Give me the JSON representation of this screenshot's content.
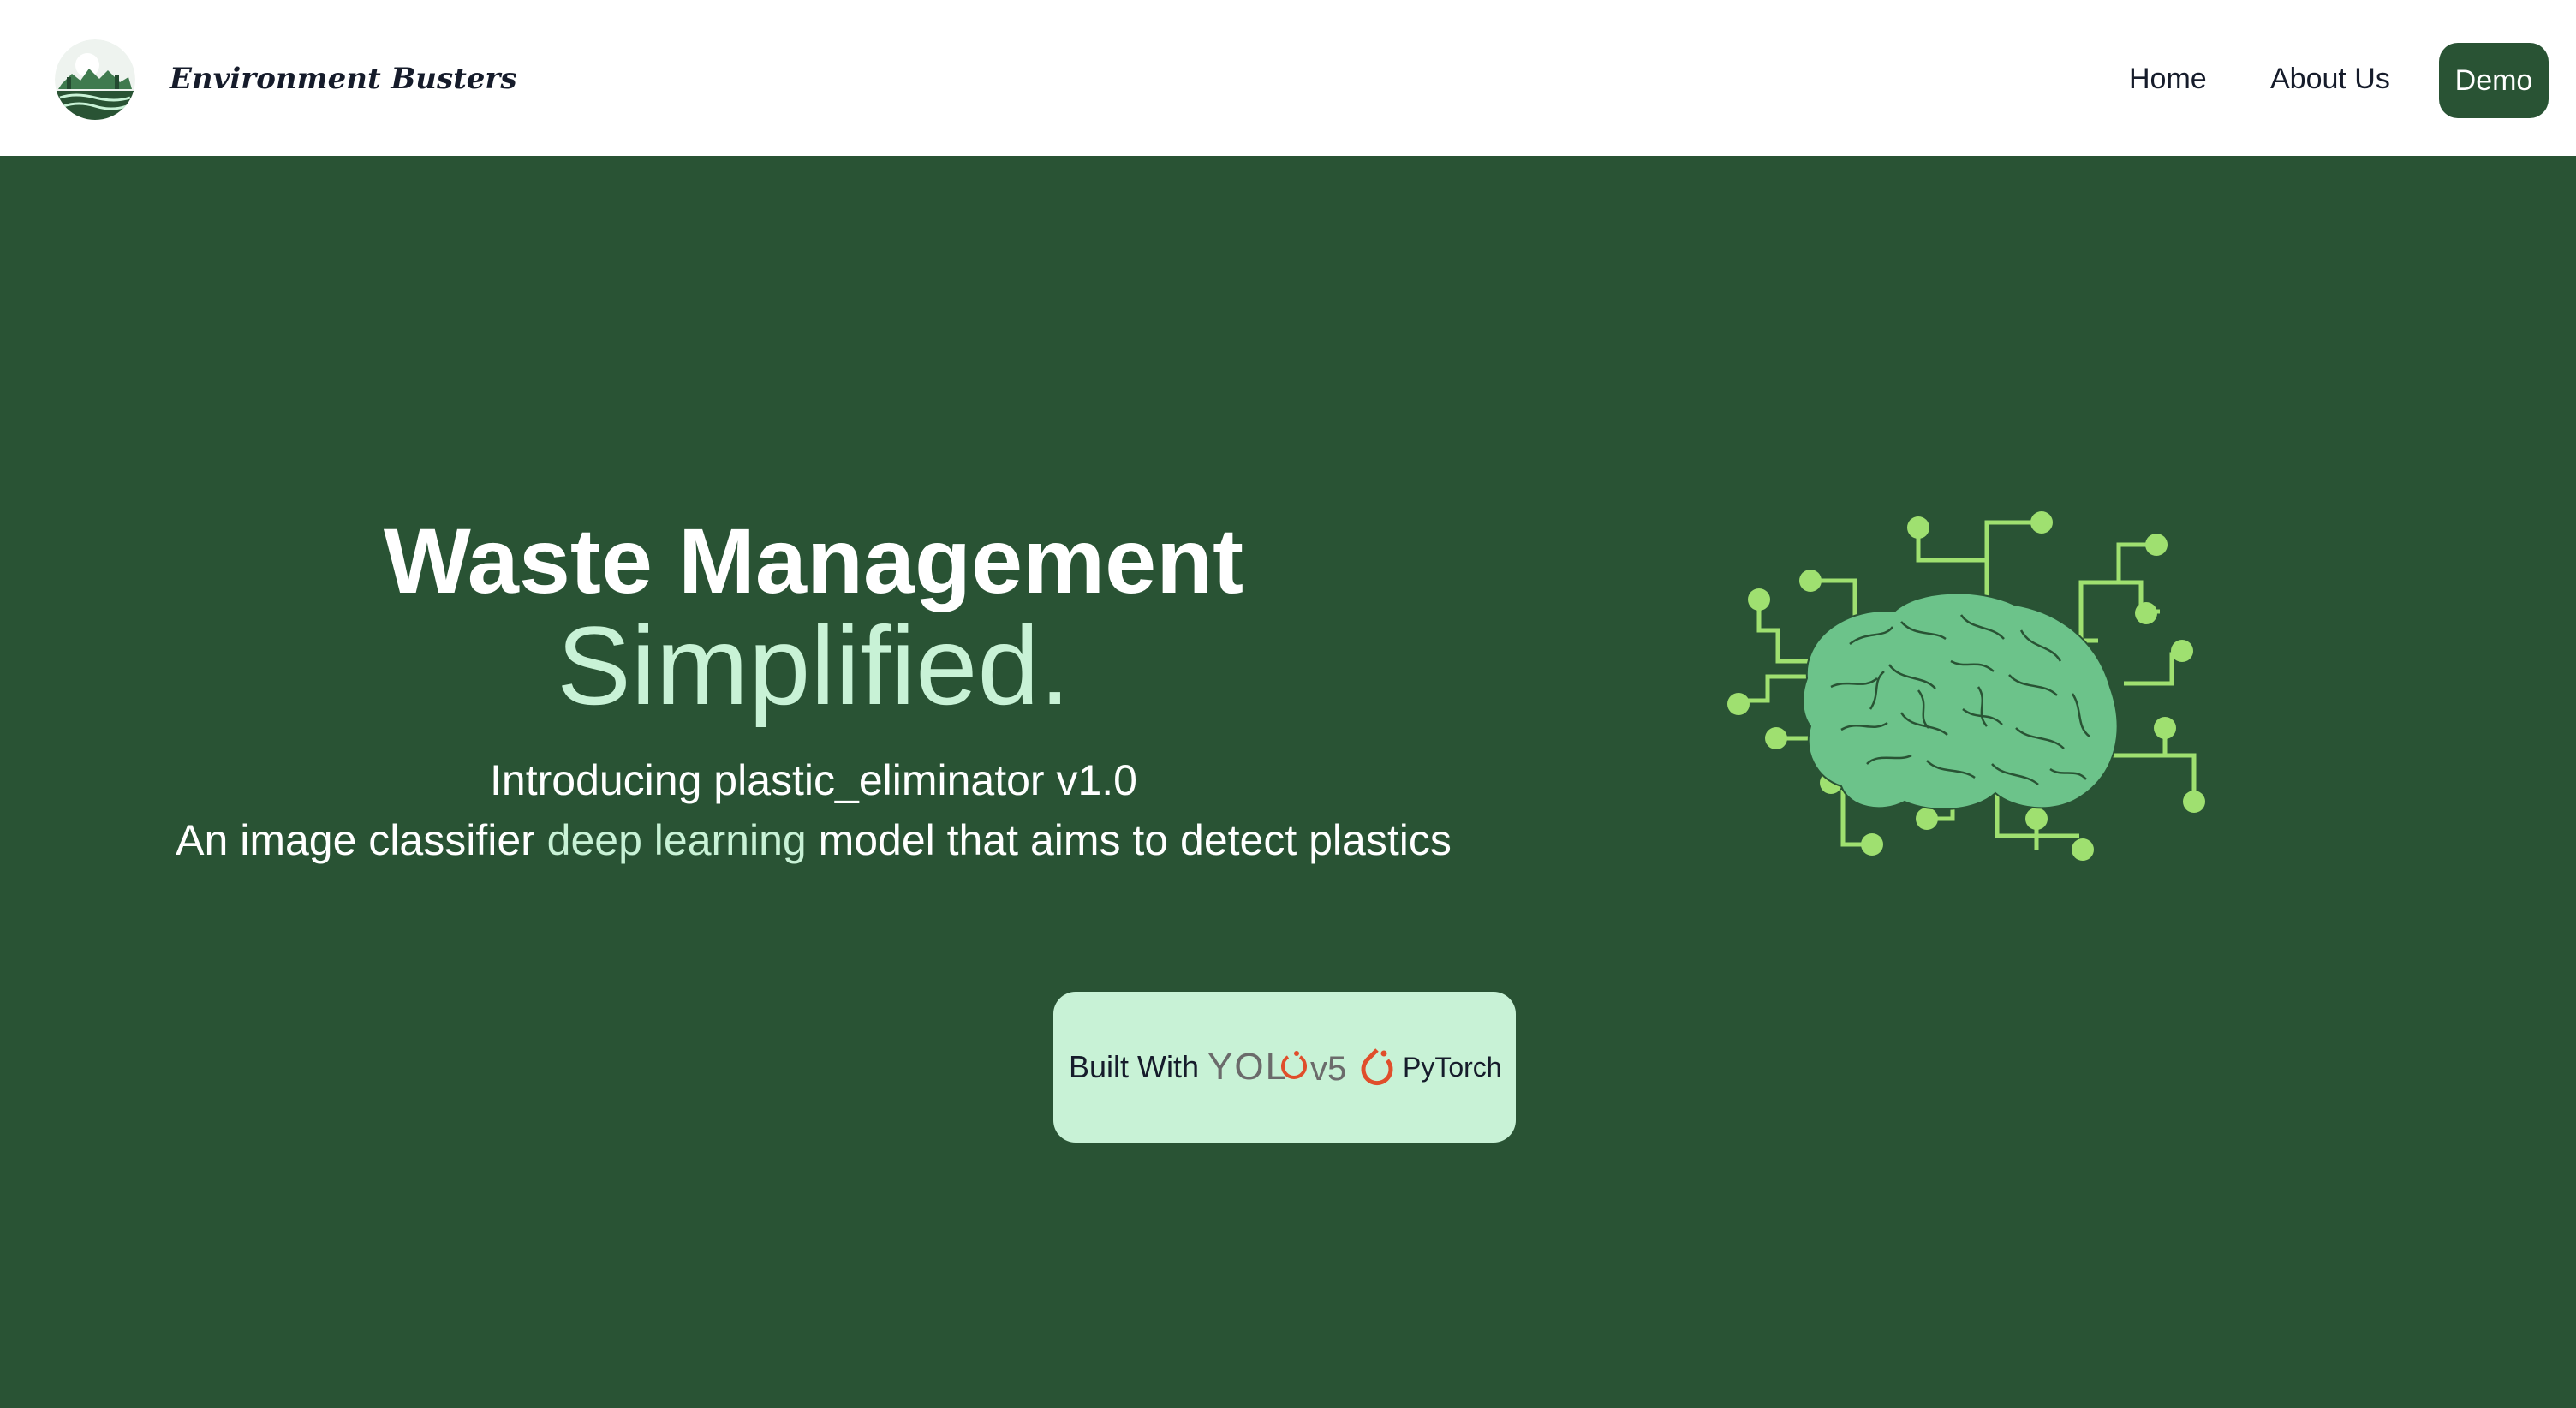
{
  "header": {
    "brand": "Environment Busters",
    "nav": {
      "home": "Home",
      "about": "About Us",
      "demo": "Demo"
    }
  },
  "hero": {
    "title": "Waste Management",
    "accent": "Simplified.",
    "intro": "Introducing plastic_eliminator v1.0",
    "desc_before": "An image classifier ",
    "desc_highlight": "deep learning",
    "desc_after": " model that aims to detect plastics"
  },
  "built_with": {
    "label": "Built With",
    "yolo_text": "YOL",
    "yolo_version": "v5",
    "pytorch": "PyTorch"
  },
  "colors": {
    "primary_green": "#295334",
    "mint_accent": "#c8f2d6",
    "brain_green": "#6cc38a",
    "circuit_green": "#9fe070",
    "pytorch_orange": "#e04e2b",
    "text_dark": "#161c2b"
  },
  "icons": {
    "logo": "environment-busters-logo",
    "brain": "circuit-brain-icon",
    "yolo": "yolo-logo",
    "pytorch": "pytorch-flame-icon"
  }
}
